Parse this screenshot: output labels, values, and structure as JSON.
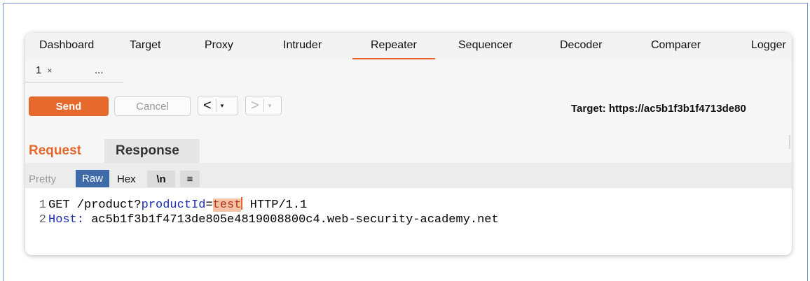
{
  "main_tabs": [
    "Dashboard",
    "Target",
    "Proxy",
    "Intruder",
    "Repeater",
    "Sequencer",
    "Decoder",
    "Comparer",
    "Logger"
  ],
  "active_main_tab": "Repeater",
  "sub_tabs": {
    "tab1_label": "1",
    "tab1_close": "×",
    "more": "..."
  },
  "toolbar": {
    "send_label": "Send",
    "cancel_label": "Cancel",
    "back_label": "<",
    "forward_label": ">",
    "dropdown_glyph": "▾",
    "target_text": "Target: https://ac5b1f3b1f4713de80"
  },
  "message_tabs": {
    "request_label": "Request",
    "response_label": "Response"
  },
  "view_modes": {
    "pretty": "Pretty",
    "raw": "Raw",
    "hex": "Hex",
    "newline": "\\n",
    "menu": "≡"
  },
  "editor": {
    "line1": {
      "num": "1",
      "method": "GET /product?",
      "param": "productId",
      "eq": "=",
      "value": "test",
      "rest": " HTTP/1.1"
    },
    "line2": {
      "num": "2",
      "header": "Host:",
      "value": " ac5b1f3b1f4713de805e4819008800c4.web-security-academy.net"
    }
  },
  "colors": {
    "accent": "#e5692d",
    "raw_selected": "#3f6aa8",
    "keyword": "#1c2db0"
  }
}
